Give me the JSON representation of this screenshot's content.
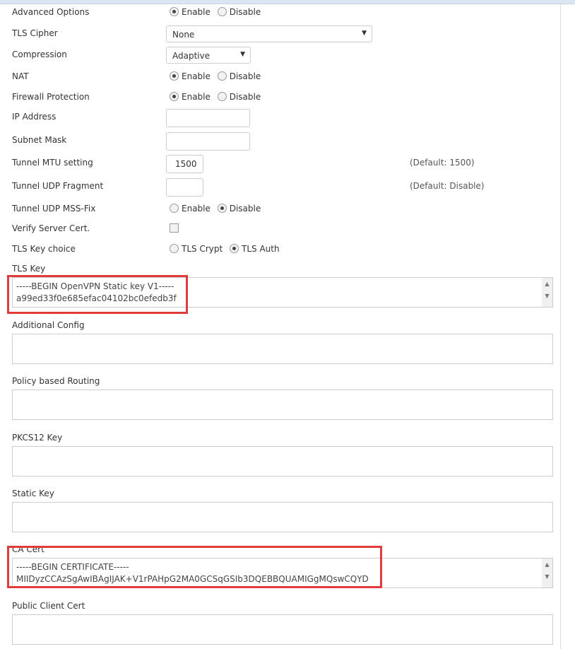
{
  "form": {
    "advanced_options": {
      "label": "Advanced Options",
      "options": [
        "Enable",
        "Disable"
      ],
      "selected": "Enable"
    },
    "tls_cipher": {
      "label": "TLS Cipher",
      "value": "None"
    },
    "compression": {
      "label": "Compression",
      "value": "Adaptive"
    },
    "nat": {
      "label": "NAT",
      "options": [
        "Enable",
        "Disable"
      ],
      "selected": "Enable"
    },
    "firewall": {
      "label": "Firewall Protection",
      "options": [
        "Enable",
        "Disable"
      ],
      "selected": "Enable"
    },
    "ip_address": {
      "label": "IP Address",
      "value": ""
    },
    "subnet_mask": {
      "label": "Subnet Mask",
      "value": ""
    },
    "tunnel_mtu": {
      "label": "Tunnel MTU setting",
      "value": "1500",
      "hint": "(Default: 1500)"
    },
    "udp_fragment": {
      "label": "Tunnel UDP Fragment",
      "value": "",
      "hint": "(Default: Disable)"
    },
    "mss_fix": {
      "label": "Tunnel UDP MSS-Fix",
      "options": [
        "Enable",
        "Disable"
      ],
      "selected": "Disable"
    },
    "verify_cert": {
      "label": "Verify Server Cert.",
      "checked": false
    },
    "tls_key_choice": {
      "label": "TLS Key choice",
      "options": [
        "TLS Crypt",
        "TLS Auth"
      ],
      "selected": "TLS Auth"
    },
    "tls_key": {
      "label": "TLS Key",
      "lines": [
        "-----BEGIN OpenVPN Static key V1-----",
        "a99ed33f0e685efac04102bc0efedb3f"
      ]
    },
    "additional_config": {
      "label": "Additional Config"
    },
    "policy_routing": {
      "label": "Policy based Routing"
    },
    "pkcs12": {
      "label": "PKCS12 Key"
    },
    "static_key": {
      "label": "Static Key"
    },
    "ca_cert": {
      "label": "CA Cert",
      "lines": [
        "-----BEGIN CERTIFICATE-----",
        "MIIDyzCCAzSgAwIBAgIJAK+V1rPAHpG2MA0GCSqGSIb3DQEBBQUAMIGgMQswCQYD"
      ]
    },
    "public_client_cert": {
      "label": "Public Client Cert"
    }
  },
  "highlight_color": "#e03c3c"
}
